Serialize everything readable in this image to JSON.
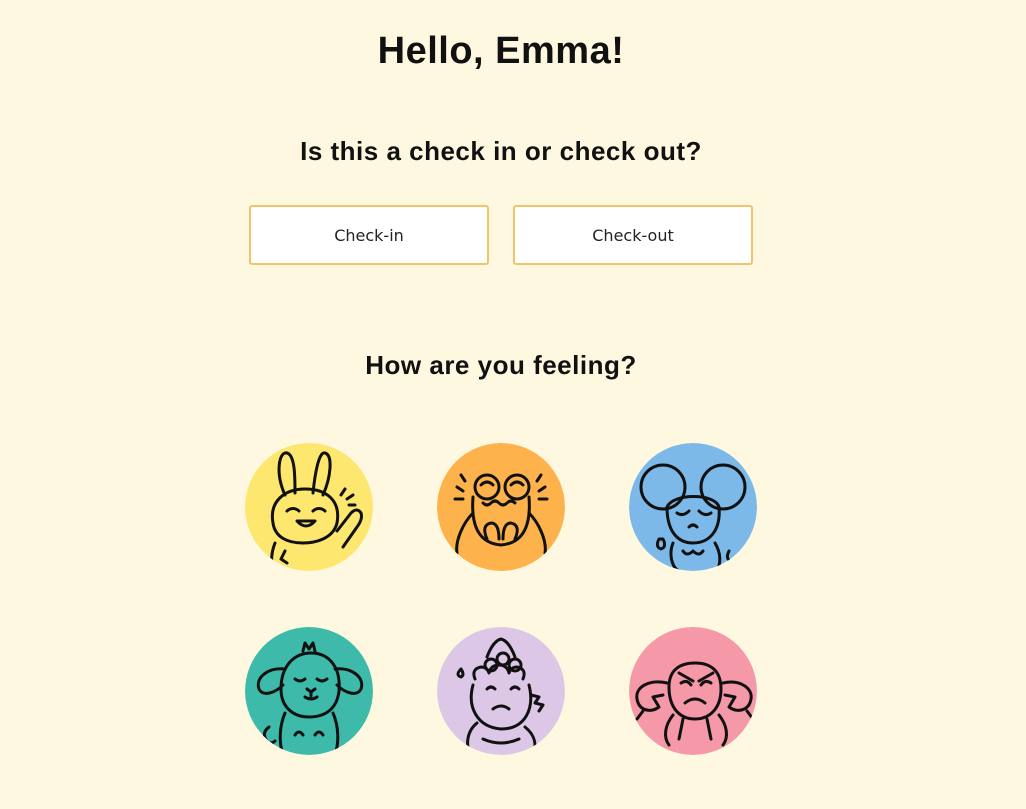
{
  "greeting": "Hello, Emma!",
  "checkin_question": "Is this a check in or check out?",
  "buttons": {
    "check_in": "Check-in",
    "check_out": "Check-out"
  },
  "feeling_question": "How are you feeling?",
  "moods": [
    {
      "icon": "happy-bunny-icon",
      "color": "#fde76e"
    },
    {
      "icon": "nervous-frog-icon",
      "color": "#fdb24c"
    },
    {
      "icon": "sad-mouse-icon",
      "color": "#7db9e8"
    },
    {
      "icon": "calm-puppy-icon",
      "color": "#3dbaa9"
    },
    {
      "icon": "worried-dino-icon",
      "color": "#dcc8e6"
    },
    {
      "icon": "angry-crab-icon",
      "color": "#f598a8"
    }
  ]
}
